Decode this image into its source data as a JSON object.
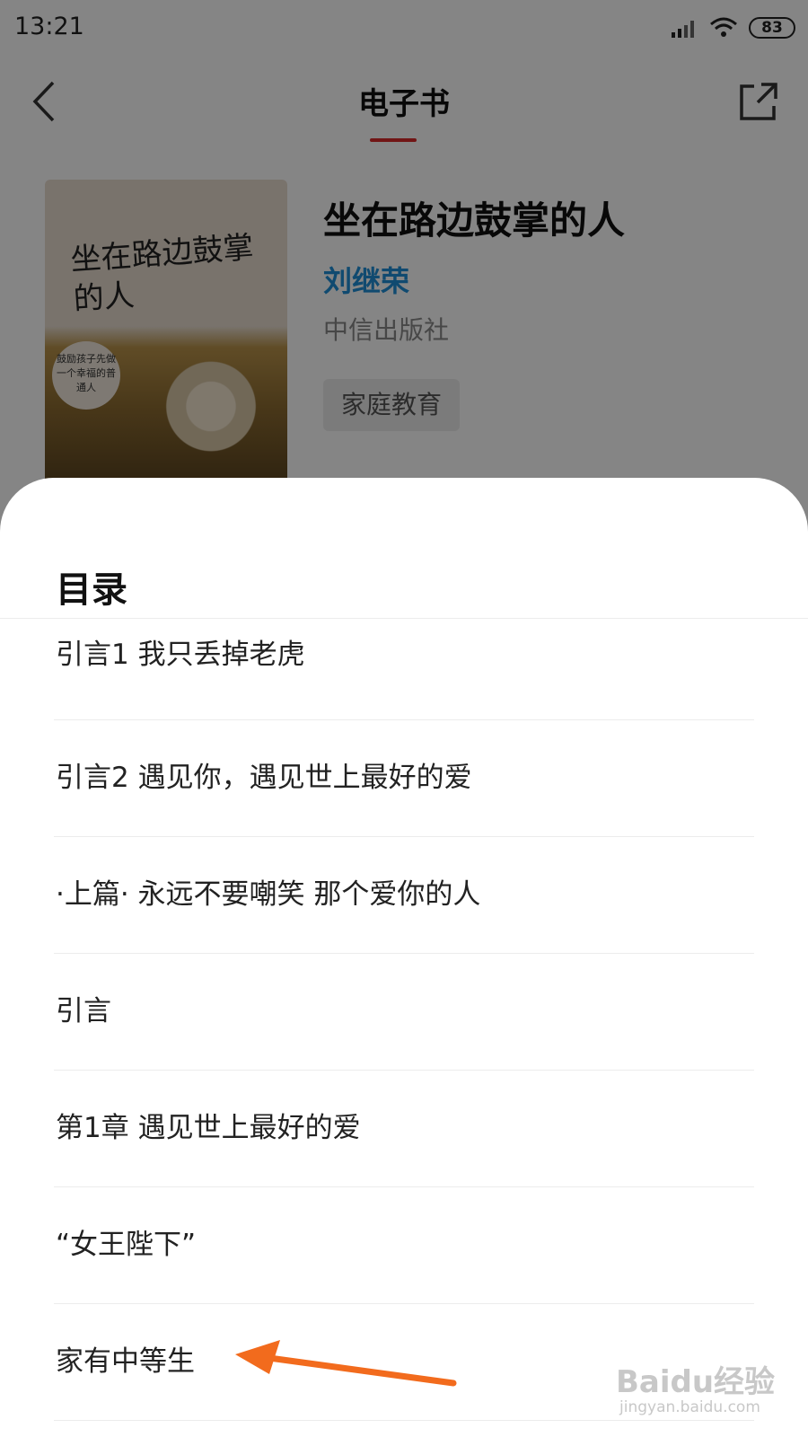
{
  "status_bar": {
    "time": "13:21",
    "battery": "83"
  },
  "header": {
    "title": "电子书"
  },
  "book": {
    "title": "坐在路边鼓掌的人",
    "author": "刘继荣",
    "publisher": "中信出版社",
    "tag": "家庭教育",
    "cover_title": "坐在路边鼓掌的人",
    "cover_badge": "鼓励孩子先做一个幸福的普通人"
  },
  "toc": {
    "title": "目录",
    "items": [
      {
        "label": "引言1 我只丢掉老虎"
      },
      {
        "label": "引言2 遇见你，遇见世上最好的爱"
      },
      {
        "label": "·上篇· 永远不要嘲笑 那个爱你的人"
      },
      {
        "label": "引言"
      },
      {
        "label": "第1章 遇见世上最好的爱"
      },
      {
        "label": "“女王陛下”"
      },
      {
        "label": "家有中等生"
      }
    ]
  },
  "watermark": {
    "text": "Baidu经验",
    "sub": "jingyan.baidu.com"
  },
  "colors": {
    "accent_red": "#d92a2a",
    "author_blue": "#1f8fd6",
    "arrow_orange": "#f26b1d"
  }
}
